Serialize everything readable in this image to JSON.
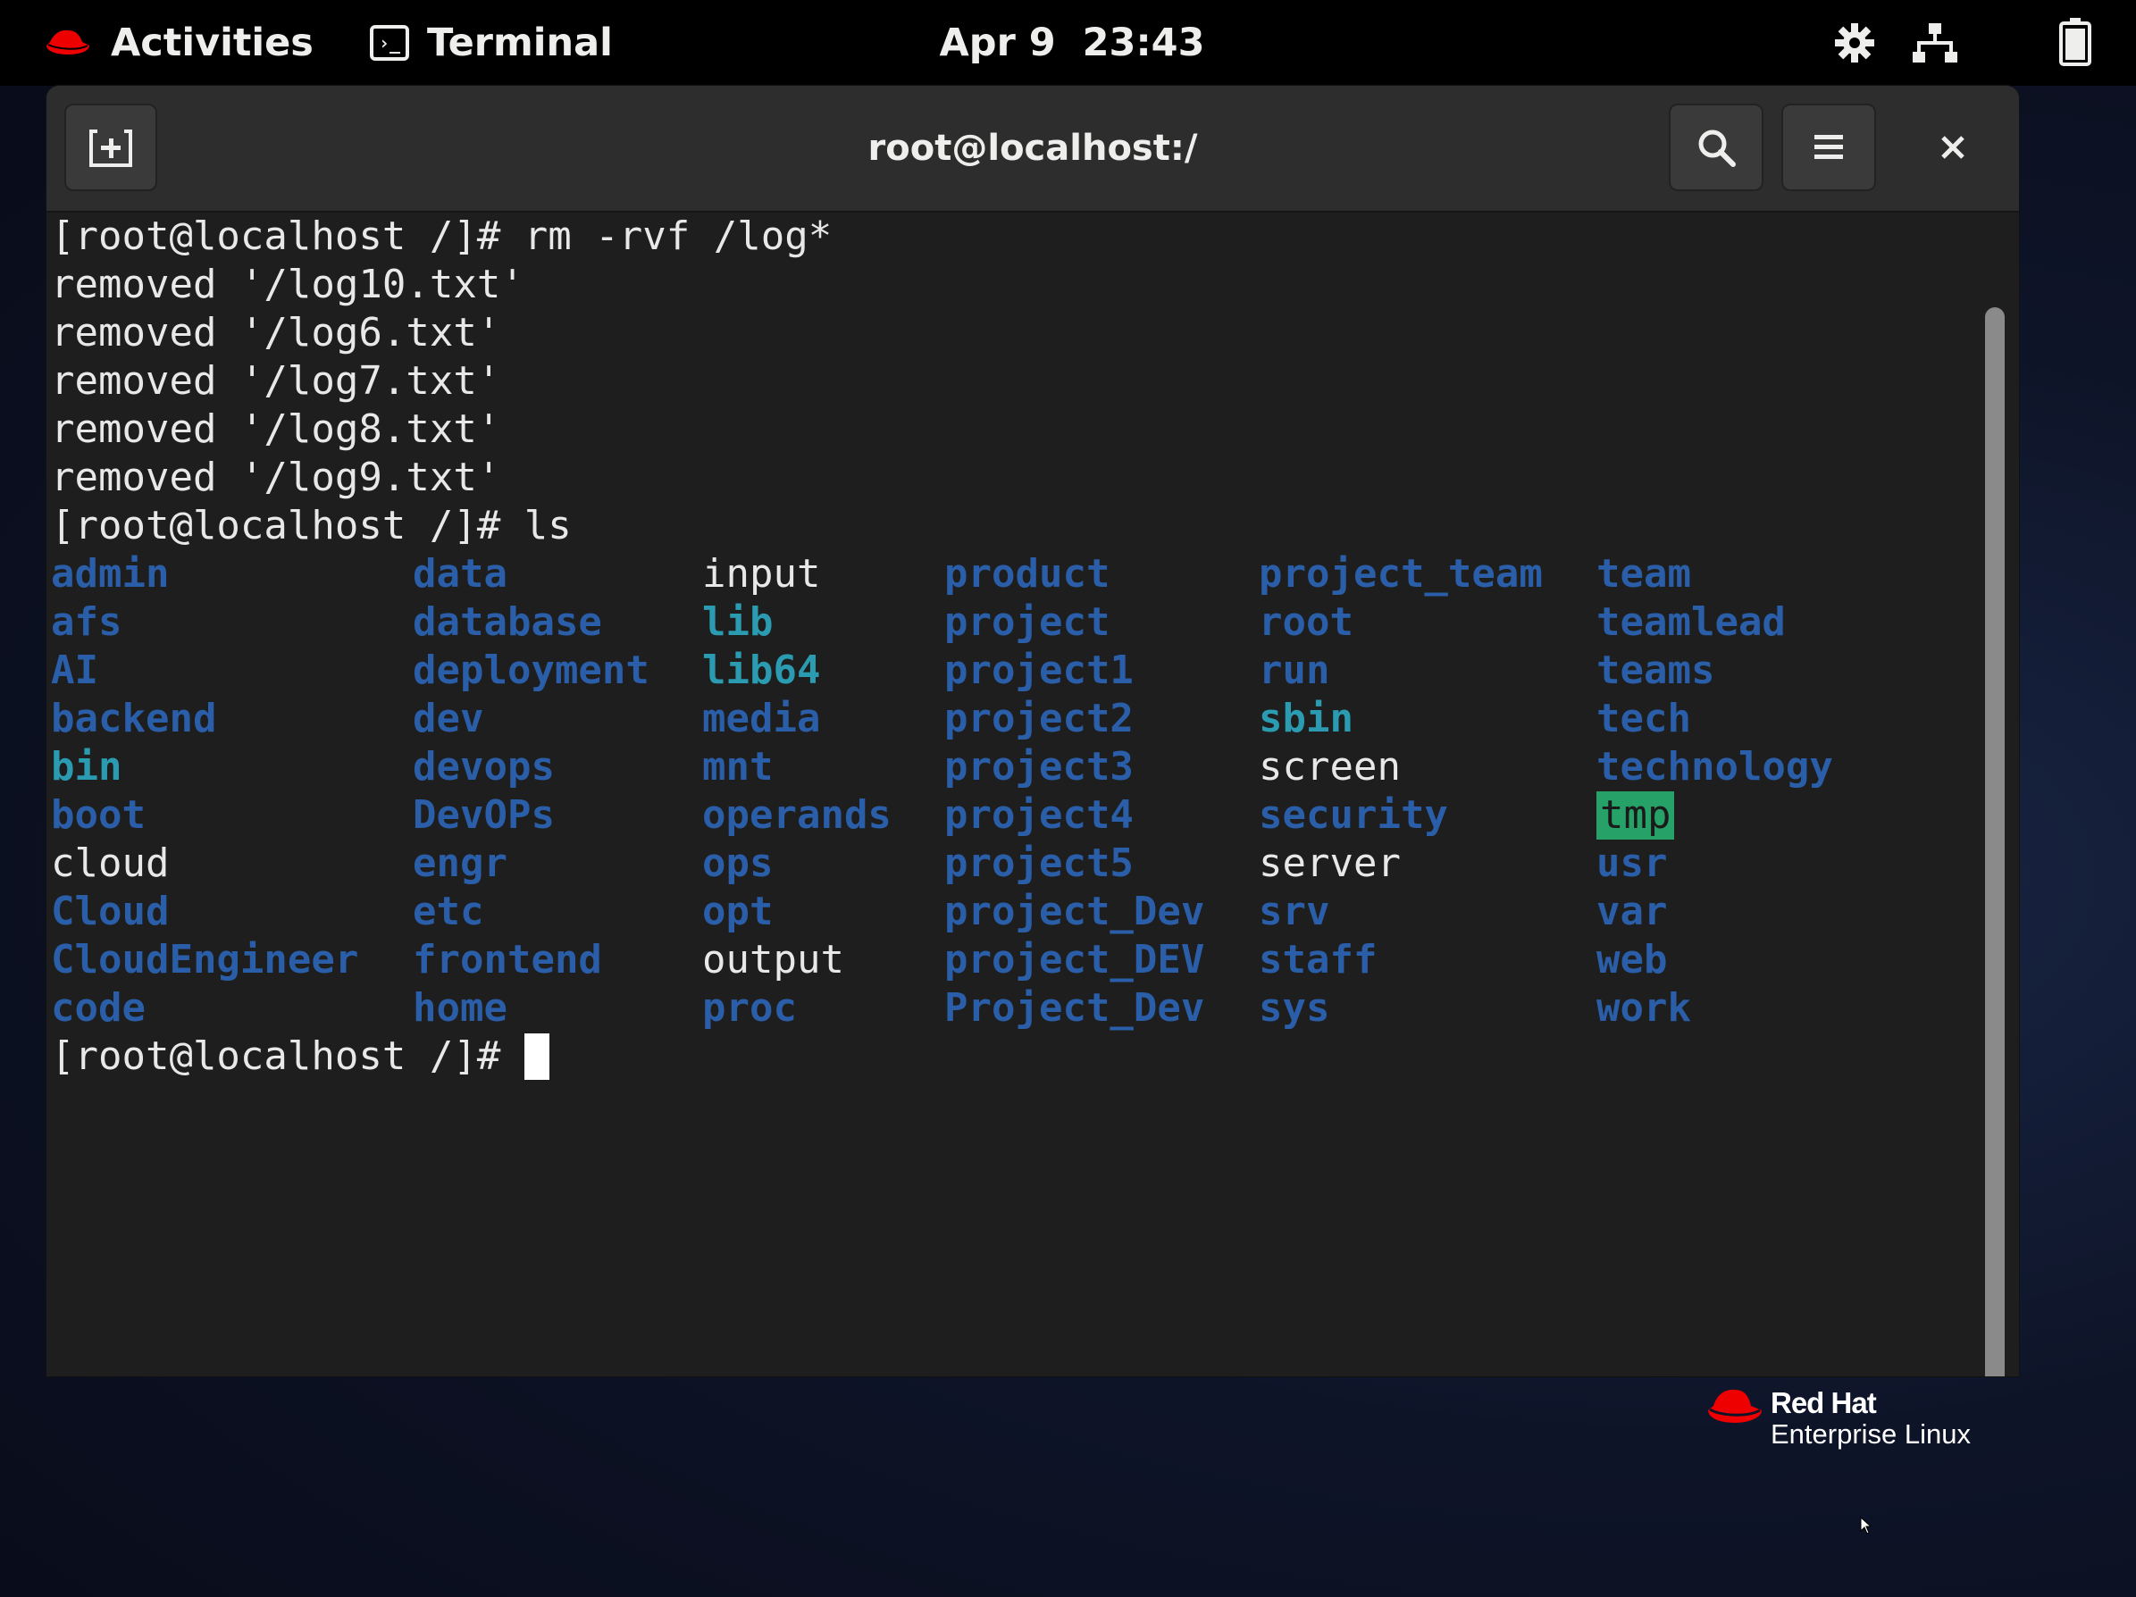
{
  "topbar": {
    "activities": "Activities",
    "app_name": "Terminal",
    "clock": "Apr 9  23:43",
    "icons": [
      "redhat-icon",
      "terminal-app-icon",
      "settings-icon",
      "network-icon",
      "battery-icon"
    ]
  },
  "window": {
    "title": "root@localhost:/",
    "buttons": [
      "new-tab-icon",
      "search-icon",
      "hamburger-menu-icon",
      "close-icon"
    ]
  },
  "terminal": {
    "lines": [
      "[root@localhost /]# rm -rvf /log*",
      "removed '/log10.txt'",
      "removed '/log6.txt'",
      "removed '/log7.txt'",
      "removed '/log8.txt'",
      "removed '/log9.txt'",
      "[root@localhost /]# ls"
    ],
    "ls_columns": [
      [
        {
          "name": "admin",
          "kind": "dir"
        },
        {
          "name": "afs",
          "kind": "dir"
        },
        {
          "name": "AI",
          "kind": "dir"
        },
        {
          "name": "backend",
          "kind": "dir"
        },
        {
          "name": "bin",
          "kind": "link"
        },
        {
          "name": "boot",
          "kind": "dir"
        },
        {
          "name": "cloud",
          "kind": "file"
        },
        {
          "name": "Cloud",
          "kind": "dir"
        },
        {
          "name": "CloudEngineer",
          "kind": "dir"
        },
        {
          "name": "code",
          "kind": "dir"
        }
      ],
      [
        {
          "name": "data",
          "kind": "dir"
        },
        {
          "name": "database",
          "kind": "dir"
        },
        {
          "name": "deployment",
          "kind": "dir"
        },
        {
          "name": "dev",
          "kind": "dir"
        },
        {
          "name": "devops",
          "kind": "dir"
        },
        {
          "name": "DevOPs",
          "kind": "dir"
        },
        {
          "name": "engr",
          "kind": "dir"
        },
        {
          "name": "etc",
          "kind": "dir"
        },
        {
          "name": "frontend",
          "kind": "dir"
        },
        {
          "name": "home",
          "kind": "dir"
        }
      ],
      [
        {
          "name": "input",
          "kind": "file"
        },
        {
          "name": "lib",
          "kind": "link"
        },
        {
          "name": "lib64",
          "kind": "link"
        },
        {
          "name": "media",
          "kind": "dir"
        },
        {
          "name": "mnt",
          "kind": "dir"
        },
        {
          "name": "operands",
          "kind": "dir"
        },
        {
          "name": "ops",
          "kind": "dir"
        },
        {
          "name": "opt",
          "kind": "dir"
        },
        {
          "name": "output",
          "kind": "file"
        },
        {
          "name": "proc",
          "kind": "dir"
        }
      ],
      [
        {
          "name": "product",
          "kind": "dir"
        },
        {
          "name": "project",
          "kind": "dir"
        },
        {
          "name": "project1",
          "kind": "dir"
        },
        {
          "name": "project2",
          "kind": "dir"
        },
        {
          "name": "project3",
          "kind": "dir"
        },
        {
          "name": "project4",
          "kind": "dir"
        },
        {
          "name": "project5",
          "kind": "dir"
        },
        {
          "name": "project_Dev",
          "kind": "dir"
        },
        {
          "name": "project_DEV",
          "kind": "dir"
        },
        {
          "name": "Project_Dev",
          "kind": "dir"
        }
      ],
      [
        {
          "name": "project_team",
          "kind": "dir"
        },
        {
          "name": "root",
          "kind": "dir"
        },
        {
          "name": "run",
          "kind": "dir"
        },
        {
          "name": "sbin",
          "kind": "link"
        },
        {
          "name": "screen",
          "kind": "file"
        },
        {
          "name": "security",
          "kind": "dir"
        },
        {
          "name": "server",
          "kind": "file"
        },
        {
          "name": "srv",
          "kind": "dir"
        },
        {
          "name": "staff",
          "kind": "dir"
        },
        {
          "name": "sys",
          "kind": "dir"
        }
      ],
      [
        {
          "name": "team",
          "kind": "dir"
        },
        {
          "name": "teamlead",
          "kind": "dir"
        },
        {
          "name": "teams",
          "kind": "dir"
        },
        {
          "name": "tech",
          "kind": "dir"
        },
        {
          "name": "technology",
          "kind": "dir"
        },
        {
          "name": "tmp",
          "kind": "sticky"
        },
        {
          "name": "usr",
          "kind": "dir"
        },
        {
          "name": "var",
          "kind": "dir"
        },
        {
          "name": "web",
          "kind": "dir"
        },
        {
          "name": "work",
          "kind": "dir"
        }
      ]
    ],
    "prompt": "[root@localhost /]# ",
    "colors": {
      "background": "#1e1e1e",
      "foreground": "#e8e8e8",
      "directory": "#2a5ea8",
      "symlink": "#2a9bb0",
      "sticky_bg": "#26a269"
    }
  },
  "branding": {
    "line1": "Red Hat",
    "line2": "Enterprise Linux",
    "accent": "#ee0000"
  }
}
